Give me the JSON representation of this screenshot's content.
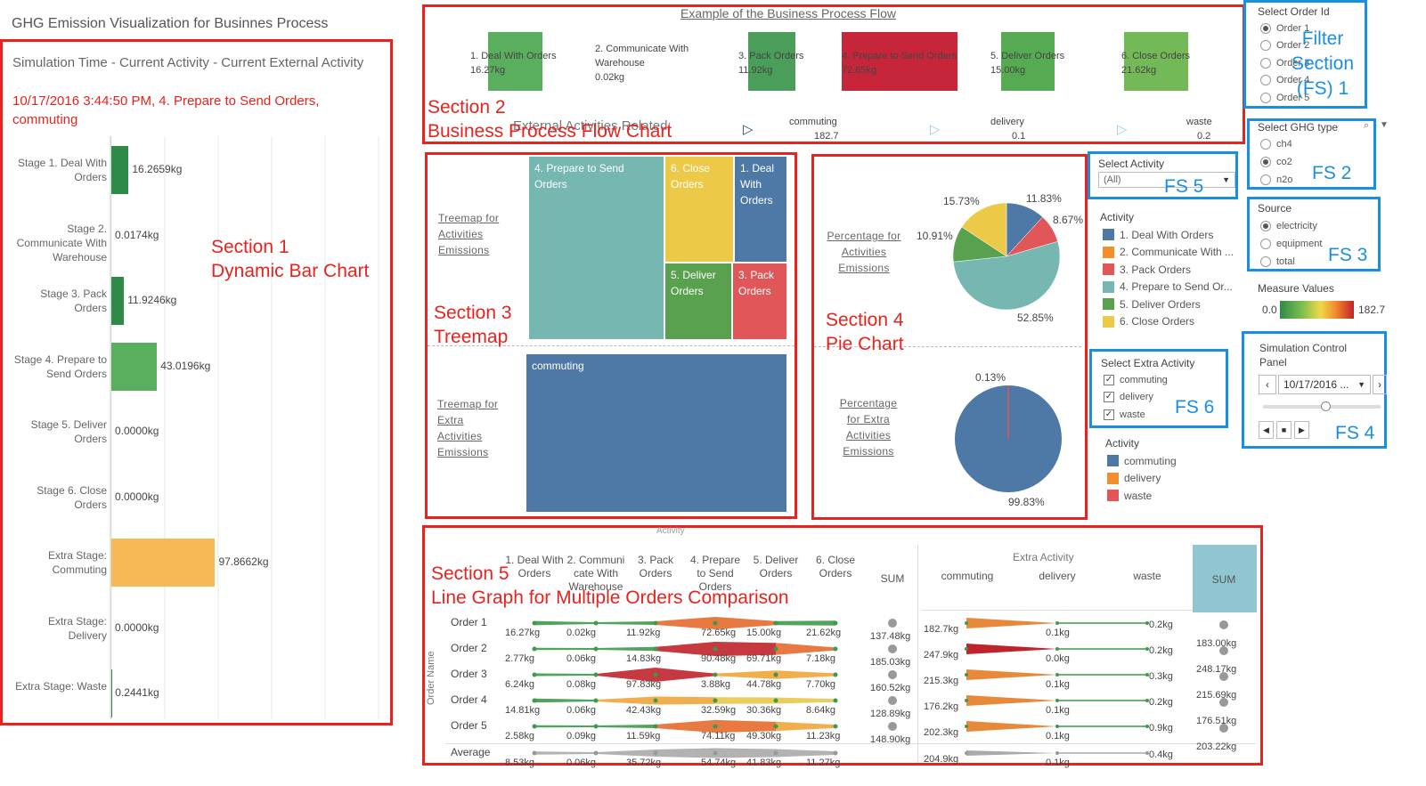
{
  "dashboard_title": "GHG Emission Visualization for Businnes Process",
  "colors": {
    "annotation_red": "#e8231e",
    "annotation_blue": "#1a8fe0",
    "deal": "#4e79a7",
    "communicate": "#f28e2b",
    "pack": "#e15759",
    "prepare": "#76b7b2",
    "deliver": "#59a14f",
    "close": "#edc948",
    "bar_dark_green": "#2e8b47",
    "bar_light_green": "#5aaf5e",
    "bar_orange": "#f7b955"
  },
  "section1": {
    "annotation": [
      "Section 1",
      "Dynamic Bar Chart"
    ],
    "header": "Simulation Time - Current Activity - Current External Activity",
    "current": "10/17/2016 3:44:50 PM, 4. Prepare to Send Orders, commuting",
    "bars": [
      {
        "label": "Stage 1. Deal With Orders",
        "value": 16.2659,
        "text": "16.2659kg"
      },
      {
        "label": "Stage 2. Communicate With Warehouse",
        "value": 0.0174,
        "text": "0.0174kg"
      },
      {
        "label": "Stage 3. Pack Orders",
        "value": 11.9246,
        "text": "11.9246kg"
      },
      {
        "label": "Stage 4. Prepare to Send Orders",
        "value": 43.0196,
        "text": "43.0196kg"
      },
      {
        "label": "Stage 5. Deliver Orders",
        "value": 0.0,
        "text": "0.0000kg"
      },
      {
        "label": "Stage 6. Close Orders",
        "value": 0.0,
        "text": "0.0000kg"
      },
      {
        "label": "Extra Stage: Commuting",
        "value": 97.8662,
        "text": "97.8662kg"
      },
      {
        "label": "Extra Stage: Delivery",
        "value": 0.0,
        "text": "0.0000kg"
      },
      {
        "label": "Extra Stage: Waste",
        "value": 0.2441,
        "text": "0.2441kg"
      }
    ]
  },
  "section2": {
    "annotation": [
      "Section 2",
      "Business Process Flow Chart"
    ],
    "title": "Example of the Business Process Flow",
    "steps": [
      {
        "name": "1. Deal With Orders",
        "value": "16.27kg"
      },
      {
        "name": "2. Communicate With Warehouse",
        "value": "0.02kg"
      },
      {
        "name": "3. Pack Orders",
        "value": "11.92kg"
      },
      {
        "name": "4. Prepare to Send Orders",
        "value": "72.65kg"
      },
      {
        "name": "5. Deliver Orders",
        "value": "15.00kg"
      },
      {
        "name": "6. Close Orders",
        "value": "21.62kg"
      }
    ],
    "external_label": "External Activities Related:",
    "externals": [
      {
        "name": "commuting",
        "value": "182.7"
      },
      {
        "name": "delivery",
        "value": "0.1"
      },
      {
        "name": "waste",
        "value": "0.2"
      }
    ]
  },
  "section3": {
    "annotation": [
      "Section 3",
      "Treemap"
    ],
    "link_activities": "Treemap for Activities Emissions",
    "link_extra": "Treemap for Extra Activities Emissions",
    "cells": {
      "prepare": "4. Prepare to Send Orders",
      "close": "6. Close Orders",
      "deal": "1. Deal With Orders",
      "deliver": "5. Deliver Orders",
      "pack": "3. Pack Orders",
      "commuting": "commuting"
    }
  },
  "section4": {
    "annotation": [
      "Section 4",
      "Pie Chart"
    ],
    "link_activities": "Percentage for Activities Emissions",
    "link_extra": "Percentage for Extra Activities Emissions",
    "pie1_labels": {
      "deal": "11.83%",
      "pack": "8.67%",
      "prepare": "52.85%",
      "deliver": "10.91%",
      "close": "15.73%"
    },
    "pie2_labels": {
      "small": "0.13%",
      "big": "99.83%"
    }
  },
  "filters": {
    "fs1_title": "Select Order Id",
    "orders": [
      "Order 1",
      "Order 2",
      "Order 3",
      "Order 4",
      "Order 5"
    ],
    "fs1_anno": [
      "Filter",
      "Section",
      "(FS) 1"
    ],
    "fs2_title": "Select GHG type",
    "ghg": [
      "ch4",
      "co2",
      "n2o"
    ],
    "fs2_anno": "FS 2",
    "fs3_title": "Source",
    "sources": [
      "electricity",
      "equipment",
      "total"
    ],
    "fs3_anno": "FS 3",
    "measure_title": "Measure Values",
    "measure_min": "0.0",
    "measure_max": "182.7",
    "fs4_title": "Simulation Control Panel",
    "fs4_date": "10/17/2016 ...",
    "fs4_anno": "FS 4",
    "fs5_title": "Select Activity",
    "fs5_value": "(All)",
    "fs5_anno": "FS 5",
    "activity_legend_title": "Activity",
    "activity_legend": [
      "1. Deal With Orders",
      "2. Communicate With ...",
      "3. Pack Orders",
      "4. Prepare to Send Or...",
      "5. Deliver Orders",
      "6. Close Orders"
    ],
    "fs6_title": "Select Extra Activity",
    "extra": [
      "commuting",
      "delivery",
      "waste"
    ],
    "fs6_anno": "FS 6",
    "extra_legend_title": "Activity",
    "extra_legend": [
      "commuting",
      "delivery",
      "waste"
    ]
  },
  "section5": {
    "annotation": [
      "Section 5",
      "Line Graph for Multiple Orders Comparison"
    ],
    "top_label": "Activity",
    "extra_header": "Extra Activity",
    "axis_label": "Order Name",
    "columns": [
      "1. Deal With Orders",
      "2. Communi cate With Warehouse",
      "3. Pack Orders",
      "4. Prepare to Send Orders",
      "5. Deliver Orders",
      "6. Close Orders",
      "SUM"
    ],
    "extra_columns": [
      "commuting",
      "delivery",
      "waste",
      "SUM"
    ],
    "rows": [
      {
        "name": "Order 1",
        "vals": [
          "16.27kg",
          "0.02kg",
          "11.92kg",
          "72.65kg",
          "15.00kg",
          "21.62kg"
        ],
        "sum": "137.48kg",
        "extra": [
          "182.7kg",
          "0.1kg",
          "0.2kg"
        ],
        "esum": "183.00kg"
      },
      {
        "name": "Order 2",
        "vals": [
          "2.77kg",
          "0.06kg",
          "14.83kg",
          "90.48kg",
          "69.71kg",
          "7.18kg"
        ],
        "sum": "185.03kg",
        "extra": [
          "247.9kg",
          "0.0kg",
          "0.2kg"
        ],
        "esum": "248.17kg"
      },
      {
        "name": "Order 3",
        "vals": [
          "6.24kg",
          "0.08kg",
          "97.83kg",
          "3.88kg",
          "44.78kg",
          "7.70kg"
        ],
        "sum": "160.52kg",
        "extra": [
          "215.3kg",
          "0.1kg",
          "0.3kg"
        ],
        "esum": "215.69kg"
      },
      {
        "name": "Order 4",
        "vals": [
          "14.81kg",
          "0.06kg",
          "42.43kg",
          "32.59kg",
          "30.36kg",
          "8.64kg"
        ],
        "sum": "128.89kg",
        "extra": [
          "176.2kg",
          "0.1kg",
          "0.2kg"
        ],
        "esum": "176.51kg"
      },
      {
        "name": "Order 5",
        "vals": [
          "2.58kg",
          "0.09kg",
          "11.59kg",
          "74.11kg",
          "49.30kg",
          "11.23kg"
        ],
        "sum": "148.90kg",
        "extra": [
          "202.3kg",
          "0.1kg",
          "0.9kg"
        ],
        "esum": "203.22kg"
      },
      {
        "name": "Average",
        "vals": [
          "8.53kg",
          "0.06kg",
          "35.72kg",
          "54.74kg",
          "41.83kg",
          "11.27kg"
        ],
        "sum": "",
        "extra": [
          "204.9kg",
          "0.1kg",
          "0.4kg"
        ],
        "esum": ""
      }
    ]
  }
}
